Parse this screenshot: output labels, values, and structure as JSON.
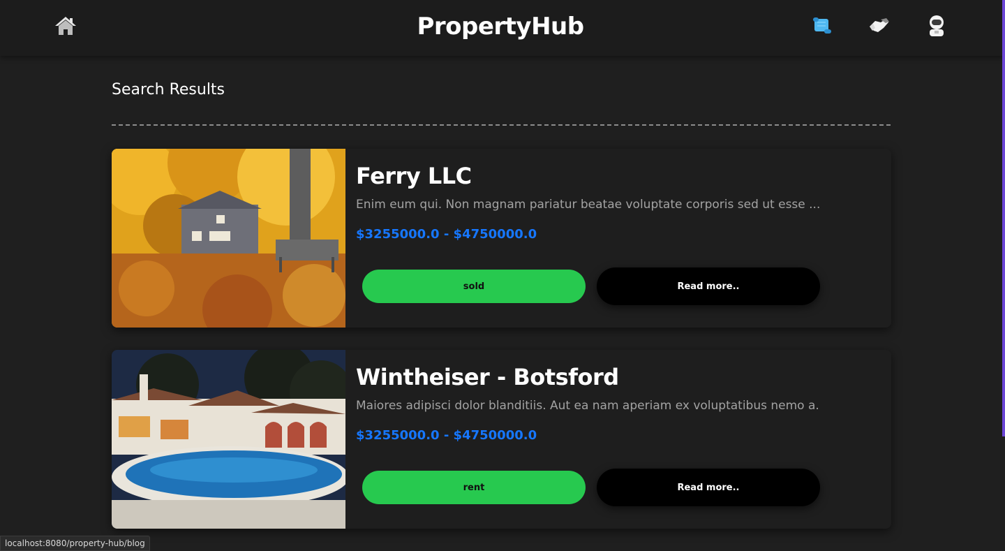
{
  "navbar": {
    "brand": "PropertyHub",
    "icons": [
      "home-icon",
      "scroll-icon",
      "handshake-icon",
      "astronaut-icon"
    ]
  },
  "page": {
    "section_title": "Search Results"
  },
  "listings": [
    {
      "title": "Ferry LLC",
      "description": "Enim eum qui. Non magnam pariatur beatae voluptate corporis sed ut esse ...",
      "price": "$3255000.0 - $4750000.0",
      "status": "sold",
      "read_more": "Read more..",
      "image": "autumn house with yellow trees and bench"
    },
    {
      "title": "Wintheiser - Botsford",
      "description": "Maiores adipisci dolor blanditiis. Aut ea nam aperiam ex voluptatibus nemo a.",
      "price": "$3255000.0 - $4750000.0",
      "status": "rent",
      "read_more": "Read more..",
      "image": "white villa with swimming pool at night"
    }
  ],
  "status_bar": {
    "url": "localhost:8080/property-hub/blog"
  },
  "colors": {
    "background": "#1f1f1f",
    "navbar": "#1c1c1c",
    "price": "#1677ff",
    "status_button": "#27c94f",
    "read_more_button": "#000000",
    "accent_edge": "#6b46d6"
  }
}
